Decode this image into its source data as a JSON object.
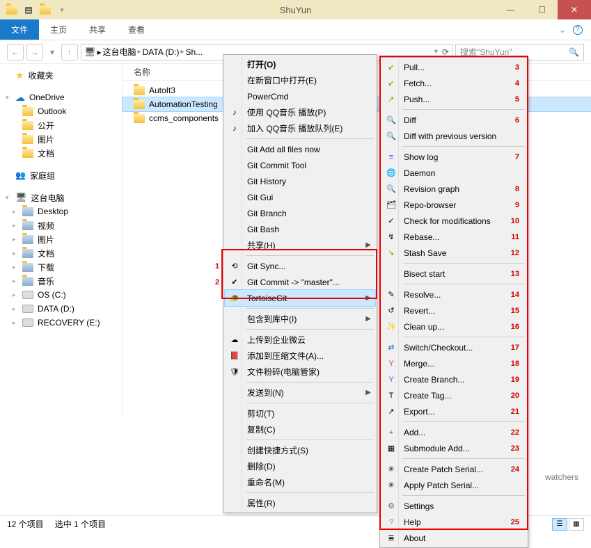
{
  "window": {
    "title": "ShuYun"
  },
  "ribbon": {
    "file": "文件",
    "home": "主页",
    "share": "共享",
    "view": "查看"
  },
  "breadcrumb": {
    "root": "这台电脑",
    "drive": "DATA (D:)",
    "folder": "Sh...",
    "refresh": "⟳"
  },
  "search": {
    "placeholder": "搜索\"ShuYun\""
  },
  "nav": {
    "favorites": "收藏夹",
    "onedrive": "OneDrive",
    "od_items": [
      "Outlook",
      "公开",
      "图片",
      "文档"
    ],
    "homegroup": "家庭组",
    "thispc": "这台电脑",
    "pc_items": [
      "Desktop",
      "视频",
      "图片",
      "文档",
      "下载",
      "音乐"
    ],
    "drives": [
      "OS (C:)",
      "DATA (D:)",
      "RECOVERY (E:)"
    ]
  },
  "columns": {
    "name": "名称"
  },
  "files": [
    {
      "name": "AutoIt3",
      "sel": false
    },
    {
      "name": "AutomationTesting",
      "sel": true
    },
    {
      "name": "ccms_components",
      "sel": false
    }
  ],
  "status": {
    "count": "12 个项目",
    "sel": "选中 1 个项目"
  },
  "watchers": "watchers",
  "menu1": [
    {
      "t": "打开(O)",
      "bold": true
    },
    {
      "t": "在新窗口中打开(E)"
    },
    {
      "t": "PowerCmd"
    },
    {
      "t": "使用 QQ音乐 播放(P)",
      "ic": "♪"
    },
    {
      "t": "加入 QQ音乐 播放队列(E)",
      "ic": "♪"
    },
    {
      "t": "-"
    },
    {
      "t": "Git Add all files now"
    },
    {
      "t": "Git Commit Tool"
    },
    {
      "t": "Git History"
    },
    {
      "t": "Git Gui"
    },
    {
      "t": "Git Branch"
    },
    {
      "t": "Git Bash"
    },
    {
      "t": "共享(H)",
      "sub": true
    },
    {
      "t": "-"
    },
    {
      "t": "Git Sync...",
      "ic": "⟲",
      "numL": "1"
    },
    {
      "t": "Git Commit -> \"master\"...",
      "ic": "✔",
      "numL": "2"
    },
    {
      "t": "TortoiseGit",
      "ic": "🐢",
      "sub": true,
      "sel": true
    },
    {
      "t": "-"
    },
    {
      "t": "包含到库中(I)",
      "sub": true
    },
    {
      "t": "-"
    },
    {
      "t": "上传到企业微云",
      "ic": "☁"
    },
    {
      "t": "添加到压缩文件(A)...",
      "ic": "📕"
    },
    {
      "t": "文件粉碎(电脑管家)",
      "ic": "🛡"
    },
    {
      "t": "-"
    },
    {
      "t": "发送到(N)",
      "sub": true
    },
    {
      "t": "-"
    },
    {
      "t": "剪切(T)"
    },
    {
      "t": "复制(C)"
    },
    {
      "t": "-"
    },
    {
      "t": "创建快捷方式(S)"
    },
    {
      "t": "删除(D)"
    },
    {
      "t": "重命名(M)"
    },
    {
      "t": "-"
    },
    {
      "t": "属性(R)"
    }
  ],
  "menu2": [
    {
      "t": "Pull...",
      "ic": "↙",
      "cls": "ico-pull",
      "num": "3"
    },
    {
      "t": "Fetch...",
      "ic": "↙",
      "cls": "ico-pull",
      "num": "4"
    },
    {
      "t": "Push...",
      "ic": "↗",
      "cls": "ico-push",
      "num": "5"
    },
    {
      "t": "-"
    },
    {
      "t": "Diff",
      "ic": "🔍",
      "cls": "ico-diff",
      "num": "6"
    },
    {
      "t": "Diff with previous version",
      "ic": "🔍",
      "cls": "ico-diff"
    },
    {
      "t": "-"
    },
    {
      "t": "Show log",
      "ic": "≡",
      "cls": "ico-log",
      "num": "7"
    },
    {
      "t": "Daemon",
      "ic": "🌐",
      "cls": "ico-globe"
    },
    {
      "t": "Revision graph",
      "ic": "🔍",
      "cls": "ico-diff",
      "num": "8"
    },
    {
      "t": "Repo-browser",
      "ic": "🗂",
      "num": "9"
    },
    {
      "t": "Check for modifications",
      "ic": "✓",
      "num": "10"
    },
    {
      "t": "Rebase...",
      "ic": "↯",
      "num": "11"
    },
    {
      "t": "Stash Save",
      "ic": "↘",
      "cls": "ico-push",
      "num": "12"
    },
    {
      "t": "-"
    },
    {
      "t": "Bisect start",
      "num": "13"
    },
    {
      "t": "-"
    },
    {
      "t": "Resolve...",
      "ic": "✎",
      "num": "14"
    },
    {
      "t": "Revert...",
      "ic": "↺",
      "num": "15"
    },
    {
      "t": "Clean up...",
      "ic": "✨",
      "num": "16"
    },
    {
      "t": "-"
    },
    {
      "t": "Switch/Checkout...",
      "ic": "⇄",
      "cls": "ico-branch",
      "num": "17"
    },
    {
      "t": "Merge...",
      "ic": "Y",
      "cls": "ico-merge",
      "num": "18"
    },
    {
      "t": "Create Branch...",
      "ic": "Y",
      "cls": "ico-branch",
      "num": "19"
    },
    {
      "t": "Create Tag...",
      "ic": "T",
      "num": "20"
    },
    {
      "t": "Export...",
      "ic": "↗",
      "num": "21"
    },
    {
      "t": "-"
    },
    {
      "t": "Add...",
      "ic": "+",
      "cls": "ico-add",
      "num": "22"
    },
    {
      "t": "Submodule Add...",
      "ic": "▦",
      "num": "23"
    },
    {
      "t": "-"
    },
    {
      "t": "Create Patch Serial...",
      "ic": "✳",
      "num": "24"
    },
    {
      "t": "Apply Patch Serial...",
      "ic": "✳"
    },
    {
      "t": "-"
    },
    {
      "t": "Settings",
      "ic": "⚙",
      "cls": "ico-gear"
    },
    {
      "t": "Help",
      "ic": "?",
      "cls": "ico-help",
      "num": "25"
    },
    {
      "t": "About",
      "ic": "≣"
    }
  ]
}
